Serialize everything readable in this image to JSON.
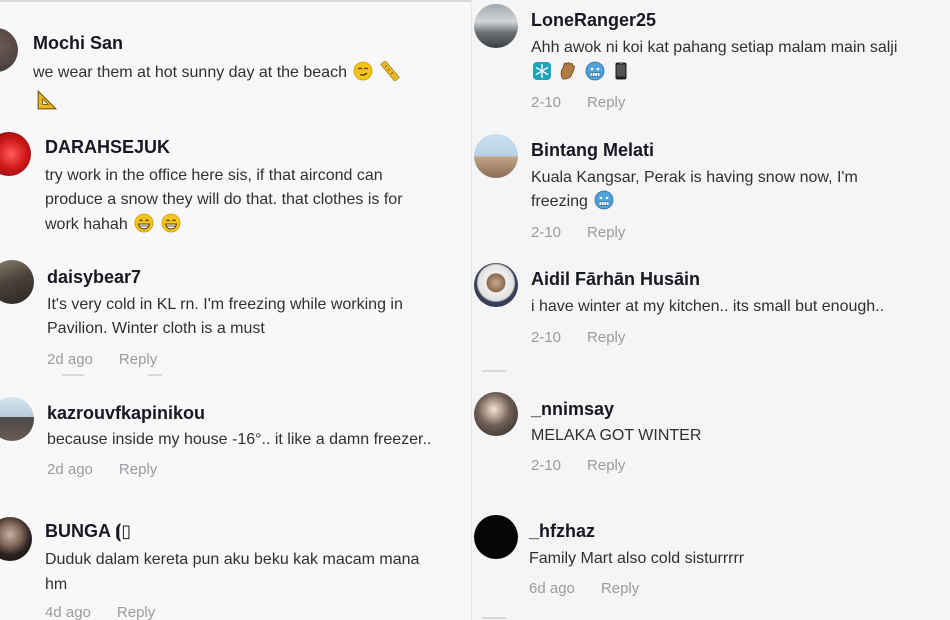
{
  "left_comments": [
    {
      "username": "Mochi San",
      "lines": [
        "we wear them at hot sunny day at the beach"
      ],
      "emoji": [
        "smirk-face-emoji",
        "ruler-emoji",
        "triangle-ruler-emoji"
      ]
    },
    {
      "username": "DARAHSEJUK",
      "lines": [
        "try work in the office here sis, if that aircond can",
        "produce a snow they will do that. that clothes is for",
        "work hahah"
      ],
      "emoji": [
        "grin-face-emoji",
        "grin-face-emoji"
      ]
    },
    {
      "username": "daisybear7",
      "lines": [
        "It's very cold in KL rn. I'm freezing while working in",
        "Pavilion. Winter cloth is a must"
      ],
      "date": "2d ago",
      "reply": "Reply"
    },
    {
      "username": "kazrouvfkapinikou",
      "lines": [
        "because inside my house -16°.. it like a damn freezer.."
      ],
      "date": "2d ago",
      "reply": "Reply"
    },
    {
      "username": "BUNGA ⦗▯",
      "lines": [
        "Duduk dalam kereta pun aku beku kak macam mana",
        "hm"
      ],
      "date": "4d ago",
      "reply": "Reply"
    }
  ],
  "right_comments": [
    {
      "username": "LoneRanger25",
      "lines": [
        "Ahh awok ni koi kat pahang setiap malam main salji"
      ],
      "emoji": [
        "snowflake-emoji",
        "hand-emoji",
        "cold-face-emoji",
        "phone-emoji"
      ],
      "date": "2-10",
      "reply": "Reply"
    },
    {
      "username": "Bintang Melati",
      "lines": [
        "Kuala Kangsar, Perak is having snow now, I'm",
        "freezing"
      ],
      "emoji": [
        "cold-face-emoji"
      ],
      "date": "2-10",
      "reply": "Reply"
    },
    {
      "username": "Aidil Fārhān Husāin",
      "lines": [
        "i have winter at my kitchen.. its small but enough.."
      ],
      "date": "2-10",
      "reply": "Reply"
    },
    {
      "username": "_nnimsay",
      "lines": [
        "MELAKA GOT WINTER"
      ],
      "date": "2-10",
      "reply": "Reply"
    },
    {
      "username": "_hfzhaz",
      "lines": [
        "Family Mart also cold sisturrrrr"
      ],
      "date": "6d ago",
      "reply": "Reply"
    }
  ]
}
